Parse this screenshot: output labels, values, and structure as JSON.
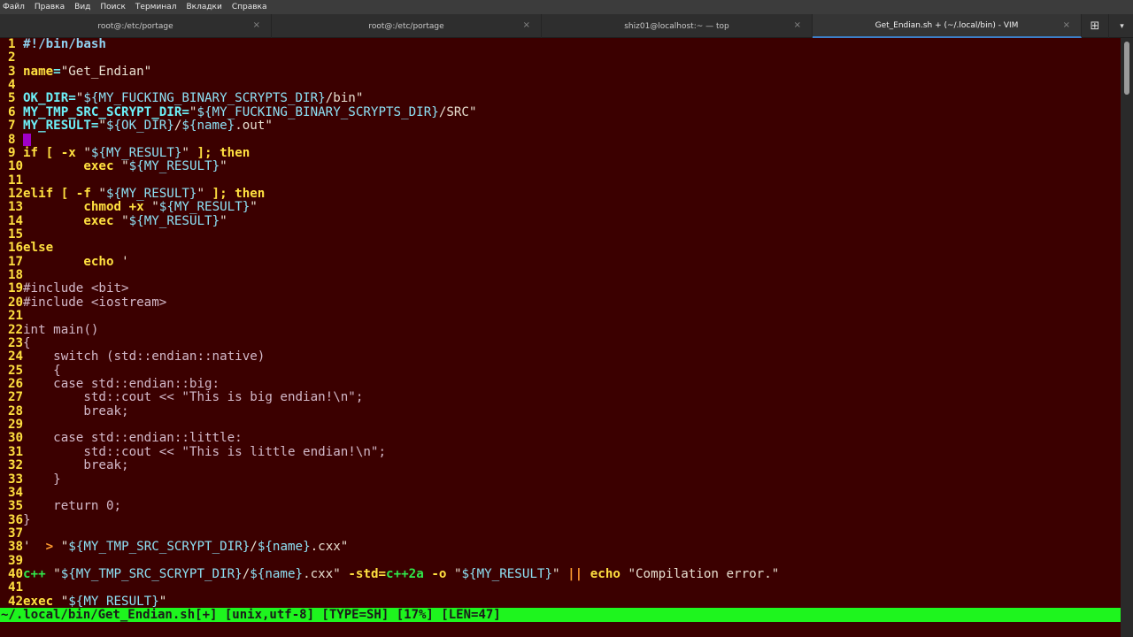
{
  "menu": [
    "Файл",
    "Правка",
    "Вид",
    "Поиск",
    "Терминал",
    "Вкладки",
    "Справка"
  ],
  "tabs": [
    {
      "title": "root@:/etc/portage",
      "close": "×"
    },
    {
      "title": "root@:/etc/portage",
      "close": "×"
    },
    {
      "title": "shiz01@localhost:~ — top",
      "close": "×"
    },
    {
      "title": "Get_Endian.sh + (~/.local/bin) - VIM",
      "close": "×"
    }
  ],
  "tab_actions": {
    "new_tab": "⊞",
    "menu": "▾"
  },
  "editor": {
    "status_line": "~/.local/bin/Get_Endian.sh[+] [unix,utf-8] [TYPE=SH] [17%] [LEN=47]",
    "cursor_line": 8,
    "lines": [
      {
        "n": "1",
        "parts": [
          {
            "c": "t-cm",
            "t": "#!/bin/bash"
          }
        ]
      },
      {
        "n": "2",
        "parts": []
      },
      {
        "n": "3",
        "parts": [
          {
            "c": "t-kw",
            "t": "name"
          },
          {
            "c": "t-asg",
            "t": "="
          },
          {
            "c": "t-str",
            "t": "\"Get_Endian\""
          }
        ]
      },
      {
        "n": "4",
        "parts": []
      },
      {
        "n": "5",
        "parts": [
          {
            "c": "t-asg",
            "t": "OK_DIR="
          },
          {
            "c": "t-str",
            "t": "\""
          },
          {
            "c": "t-var",
            "t": "${MY_FUCKING_BINARY_SCRYPTS_DIR}"
          },
          {
            "c": "t-str",
            "t": "/bin\""
          }
        ]
      },
      {
        "n": "6",
        "parts": [
          {
            "c": "t-asg",
            "t": "MY_TMP_SRC_SCRYPT_DIR="
          },
          {
            "c": "t-str",
            "t": "\""
          },
          {
            "c": "t-var",
            "t": "${MY_FUCKING_BINARY_SCRYPTS_DIR}"
          },
          {
            "c": "t-str",
            "t": "/SRC\""
          }
        ]
      },
      {
        "n": "7",
        "parts": [
          {
            "c": "t-asg",
            "t": "MY_RESULT="
          },
          {
            "c": "t-str",
            "t": "\""
          },
          {
            "c": "t-var",
            "t": "${OK_DIR}"
          },
          {
            "c": "t-str",
            "t": "/"
          },
          {
            "c": "t-var",
            "t": "${name}"
          },
          {
            "c": "t-str",
            "t": ".out\""
          }
        ]
      },
      {
        "n": "8",
        "parts": []
      },
      {
        "n": "9",
        "parts": [
          {
            "c": "t-kw",
            "t": "if"
          },
          {
            "c": "t-pl",
            "t": " "
          },
          {
            "c": "t-kw",
            "t": "[ -x "
          },
          {
            "c": "t-str",
            "t": "\""
          },
          {
            "c": "t-var",
            "t": "${MY_RESULT}"
          },
          {
            "c": "t-str",
            "t": "\""
          },
          {
            "c": "t-kw",
            "t": " ]; then"
          }
        ]
      },
      {
        "n": "10",
        "parts": [
          {
            "c": "t-pl",
            "t": "        "
          },
          {
            "c": "t-kw",
            "t": "exec"
          },
          {
            "c": "t-pl",
            "t": " "
          },
          {
            "c": "t-str",
            "t": "\""
          },
          {
            "c": "t-var",
            "t": "${MY_RESULT}"
          },
          {
            "c": "t-str",
            "t": "\""
          }
        ]
      },
      {
        "n": "11",
        "parts": []
      },
      {
        "n": "12",
        "parts": [
          {
            "c": "t-kw",
            "t": "elif [ -f "
          },
          {
            "c": "t-str",
            "t": "\""
          },
          {
            "c": "t-var",
            "t": "${MY_RESULT}"
          },
          {
            "c": "t-str",
            "t": "\""
          },
          {
            "c": "t-kw",
            "t": " ]; then"
          }
        ]
      },
      {
        "n": "13",
        "parts": [
          {
            "c": "t-pl",
            "t": "        "
          },
          {
            "c": "t-kw",
            "t": "chmod +x"
          },
          {
            "c": "t-pl",
            "t": " "
          },
          {
            "c": "t-str",
            "t": "\""
          },
          {
            "c": "t-var",
            "t": "${MY_RESULT}"
          },
          {
            "c": "t-str",
            "t": "\""
          }
        ]
      },
      {
        "n": "14",
        "parts": [
          {
            "c": "t-pl",
            "t": "        "
          },
          {
            "c": "t-kw",
            "t": "exec"
          },
          {
            "c": "t-pl",
            "t": " "
          },
          {
            "c": "t-str",
            "t": "\""
          },
          {
            "c": "t-var",
            "t": "${MY_RESULT}"
          },
          {
            "c": "t-str",
            "t": "\""
          }
        ]
      },
      {
        "n": "15",
        "parts": []
      },
      {
        "n": "16",
        "parts": [
          {
            "c": "t-kw",
            "t": "else"
          }
        ]
      },
      {
        "n": "17",
        "parts": [
          {
            "c": "t-pl",
            "t": "        "
          },
          {
            "c": "t-kw",
            "t": "echo"
          },
          {
            "c": "t-pl",
            "t": " "
          },
          {
            "c": "t-str",
            "t": "'"
          }
        ]
      },
      {
        "n": "18",
        "parts": []
      },
      {
        "n": "19",
        "parts": [
          {
            "c": "t-pl",
            "t": "#include <bit>"
          }
        ]
      },
      {
        "n": "20",
        "parts": [
          {
            "c": "t-pl",
            "t": "#include <iostream>"
          }
        ]
      },
      {
        "n": "21",
        "parts": []
      },
      {
        "n": "22",
        "parts": [
          {
            "c": "t-pl",
            "t": "int main()"
          }
        ]
      },
      {
        "n": "23",
        "parts": [
          {
            "c": "t-pl",
            "t": "{"
          }
        ]
      },
      {
        "n": "24",
        "parts": [
          {
            "c": "t-pl",
            "t": "    switch (std::endian::native)"
          }
        ]
      },
      {
        "n": "25",
        "parts": [
          {
            "c": "t-pl",
            "t": "    {"
          }
        ]
      },
      {
        "n": "26",
        "parts": [
          {
            "c": "t-pl",
            "t": "    case std::endian::big:"
          }
        ]
      },
      {
        "n": "27",
        "parts": [
          {
            "c": "t-pl",
            "t": "        std::cout << \"This is big endian!\\n\";"
          }
        ]
      },
      {
        "n": "28",
        "parts": [
          {
            "c": "t-pl",
            "t": "        break;"
          }
        ]
      },
      {
        "n": "29",
        "parts": []
      },
      {
        "n": "30",
        "parts": [
          {
            "c": "t-pl",
            "t": "    case std::endian::little:"
          }
        ]
      },
      {
        "n": "31",
        "parts": [
          {
            "c": "t-pl",
            "t": "        std::cout << \"This is little endian!\\n\";"
          }
        ]
      },
      {
        "n": "32",
        "parts": [
          {
            "c": "t-pl",
            "t": "        break;"
          }
        ]
      },
      {
        "n": "33",
        "parts": [
          {
            "c": "t-pl",
            "t": "    }"
          }
        ]
      },
      {
        "n": "34",
        "parts": []
      },
      {
        "n": "35",
        "parts": [
          {
            "c": "t-pl",
            "t": "    return 0;"
          }
        ]
      },
      {
        "n": "36",
        "parts": [
          {
            "c": "t-pl",
            "t": "}"
          }
        ]
      },
      {
        "n": "37",
        "parts": []
      },
      {
        "n": "38",
        "parts": [
          {
            "c": "t-str",
            "t": "'"
          },
          {
            "c": "t-pl",
            "t": "  "
          },
          {
            "c": "t-op",
            "t": ">"
          },
          {
            "c": "t-pl",
            "t": " "
          },
          {
            "c": "t-str",
            "t": "\""
          },
          {
            "c": "t-var",
            "t": "${MY_TMP_SRC_SCRYPT_DIR}"
          },
          {
            "c": "t-str",
            "t": "/"
          },
          {
            "c": "t-var",
            "t": "${name}"
          },
          {
            "c": "t-str",
            "t": ".cxx\""
          }
        ]
      },
      {
        "n": "39",
        "parts": []
      },
      {
        "n": "40",
        "parts": [
          {
            "c": "t-gr",
            "t": "c++"
          },
          {
            "c": "t-pl",
            "t": " "
          },
          {
            "c": "t-str",
            "t": "\""
          },
          {
            "c": "t-var",
            "t": "${MY_TMP_SRC_SCRYPT_DIR}"
          },
          {
            "c": "t-str",
            "t": "/"
          },
          {
            "c": "t-var",
            "t": "${name}"
          },
          {
            "c": "t-str",
            "t": ".cxx\""
          },
          {
            "c": "t-pl",
            "t": " "
          },
          {
            "c": "t-kw",
            "t": "-std="
          },
          {
            "c": "t-gr",
            "t": "c++2a"
          },
          {
            "c": "t-pl",
            "t": " "
          },
          {
            "c": "t-kw",
            "t": "-o"
          },
          {
            "c": "t-pl",
            "t": " "
          },
          {
            "c": "t-str",
            "t": "\""
          },
          {
            "c": "t-var",
            "t": "${MY_RESULT}"
          },
          {
            "c": "t-str",
            "t": "\""
          },
          {
            "c": "t-pl",
            "t": " "
          },
          {
            "c": "t-op",
            "t": "||"
          },
          {
            "c": "t-pl",
            "t": " "
          },
          {
            "c": "t-kw",
            "t": "echo"
          },
          {
            "c": "t-pl",
            "t": " "
          },
          {
            "c": "t-str",
            "t": "\"Compilation error.\""
          }
        ]
      },
      {
        "n": "41",
        "parts": []
      },
      {
        "n": "42",
        "parts": [
          {
            "c": "t-kw",
            "t": "exec"
          },
          {
            "c": "t-pl",
            "t": " "
          },
          {
            "c": "t-str",
            "t": "\""
          },
          {
            "c": "t-var",
            "t": "${MY_RESULT}"
          },
          {
            "c": "t-str",
            "t": "\""
          }
        ]
      }
    ]
  }
}
